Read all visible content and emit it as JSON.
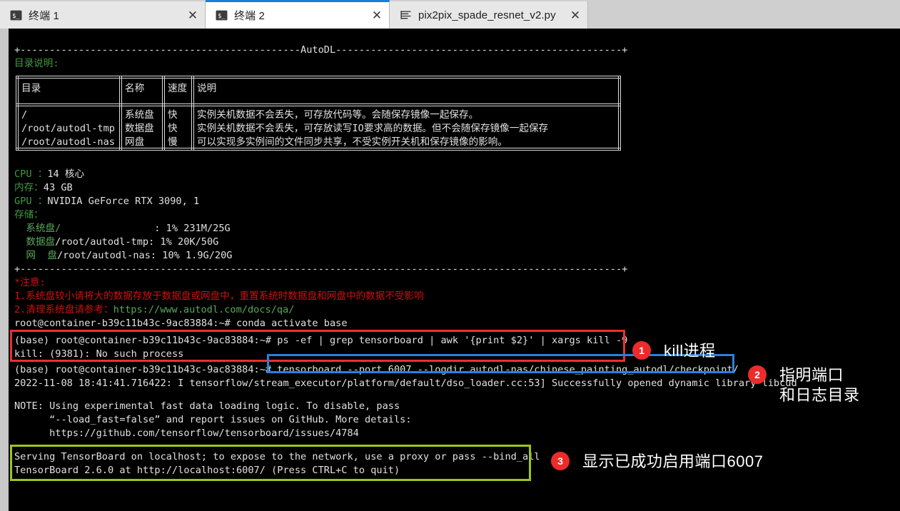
{
  "tabs": [
    {
      "label": "终端 1",
      "icon": "terminal-icon",
      "close": "✕",
      "active": false
    },
    {
      "label": "终端 2",
      "icon": "terminal-icon",
      "close": "✕",
      "active": true
    },
    {
      "label": "pix2pix_spade_resnet_v2.py",
      "icon": "python-file-icon",
      "close": "✕",
      "active": false
    }
  ],
  "terminal": {
    "banner_top": "+------------------------------------------------AutoDL-------------------------------------------------+",
    "banner_bottom": "+-------------------------------------------------------------------------------------------------------+",
    "dir_section_title": "目录说明:",
    "table": {
      "headers": [
        "目录",
        "名称",
        "速度",
        "说明"
      ],
      "rows": [
        [
          "/",
          "系统盘",
          "快",
          "实例关机数据不会丢失，可存放代码等。会随保存镜像一起保存。"
        ],
        [
          "/root/autodl-tmp",
          "数据盘",
          "快",
          "实例关机数据不会丢失，可存放读写IO要求高的数据。但不会随保存镜像一起保存"
        ],
        [
          "/root/autodl-nas",
          "网盘",
          "慢",
          "可以实现多实例间的文件同步共享，不受实例开关机和保存镜像的影响。"
        ]
      ]
    },
    "specs": [
      {
        "label": "CPU ：",
        "value": "14 核心"
      },
      {
        "label": "内存：",
        "value": "43 GB"
      },
      {
        "label": "GPU ：",
        "value": "NVIDIA GeForce RTX 3090, 1"
      }
    ],
    "storage_title": "存储：",
    "storage": [
      {
        "label": "  系统盘/",
        "path": "",
        "pad": "                : ",
        "value": "1% 231M/25G"
      },
      {
        "label": "  数据盘",
        "path": "/root/autodl-tmp",
        "pad": ": ",
        "value": "1% 20K/50G"
      },
      {
        "label": "  网  盘",
        "path": "/root/autodl-nas",
        "pad": ": ",
        "value": "10% 1.9G/20G"
      }
    ],
    "notice_title": "*注意:",
    "notice_1": "1.系统盘较小请将大的数据存放于数据盘或网盘中，重置系统时数据盘和网盘中的数据不受影响",
    "notice_2_label": "2.清理系统盘请参考：",
    "notice_2_url": "https://www.autodl.com/docs/qa/",
    "lines": {
      "prompt_root": "root@container-b39c11b43c-9ac83884:~# ",
      "cmd_conda": "conda activate base",
      "prompt_base": "(base) root@container-b39c11b43c-9ac83884:~# ",
      "cmd_kill": "ps -ef | grep tensorboard | awk '{print $2}' | xargs kill -9",
      "out_kill": "kill: (9381): No such process",
      "cmd_tensorboard": "tensorboard --port 6007 --logdir autodl-nas/chinese_painting_autodl/checkpoint/",
      "tf_log": "2022-11-08 18:41:41.716422: I tensorflow/stream_executor/platform/default/dso_loader.cc:53] Successfully opened dynamic library libcud",
      "note_1": "NOTE: Using experimental fast data loading logic. To disable, pass",
      "note_2": "      “--load_fast=false” and report issues on GitHub. More details:",
      "note_3": "      https://github.com/tensorflow/tensorboard/issues/4784",
      "serve_1": "Serving TensorBoard on localhost; to expose to the network, use a proxy or pass --bind_all",
      "serve_2": "TensorBoard 2.6.0 at http://localhost:6007/ (Press CTRL+C to quit)"
    }
  },
  "annotations": [
    {
      "number": "1",
      "text": "kill进程"
    },
    {
      "number": "2",
      "text": "指明端口\n和日志目录"
    },
    {
      "number": "3",
      "text": "显示已成功启用端口6007"
    }
  ],
  "colors": {
    "accent_blue": "#2a7fe0",
    "highlight_red": "#ec2f2f",
    "highlight_green": "#9cc420",
    "badge_red": "#ec2b2b",
    "terminal_bg": "#000000",
    "terminal_green": "#3f9b3f",
    "terminal_red": "#d01010"
  }
}
